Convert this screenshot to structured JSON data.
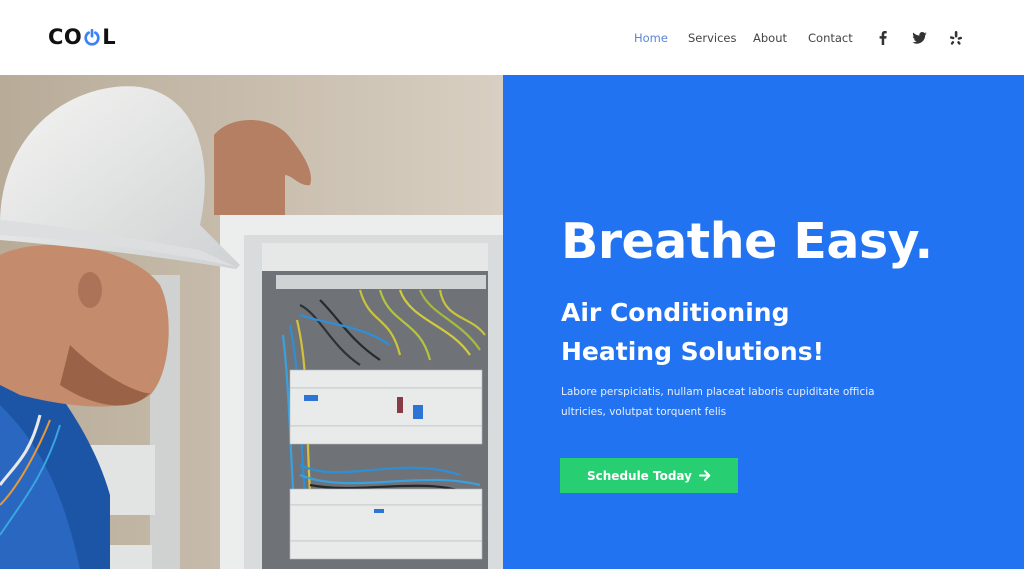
{
  "brand": {
    "logo_prefix": "CO",
    "logo_suffix": "L",
    "logo_icon": "power-icon",
    "accent_color": "#3b82f6"
  },
  "nav": {
    "items": [
      {
        "label": "Home",
        "active": true
      },
      {
        "label": "Services",
        "active": false
      },
      {
        "label": "About",
        "active": false
      },
      {
        "label": "Contact",
        "active": false
      }
    ],
    "social": [
      {
        "icon": "facebook-icon"
      },
      {
        "icon": "twitter-icon"
      },
      {
        "icon": "yelp-icon"
      }
    ]
  },
  "hero": {
    "image_alt": "Technician in white hard hat inspecting an electrical panel",
    "headline": "Breathe Easy.",
    "subheadline_lines": [
      "Air Conditioning",
      "Heating Solutions!"
    ],
    "description_lines": [
      "Labore perspiciatis, nullam placeat laboris cupiditate officia",
      "ultricies, volutpat torquent felis"
    ],
    "cta_label": "Schedule Today",
    "cta_icon": "arrow-right-icon",
    "panel_color": "#2273f2",
    "cta_color": "#27cf72"
  }
}
